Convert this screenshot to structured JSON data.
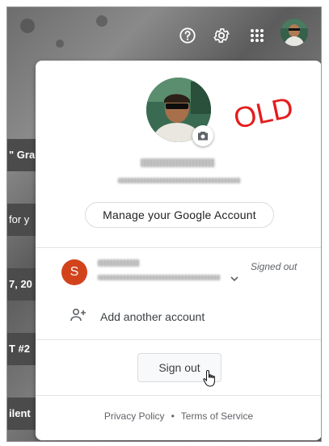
{
  "topbar": {
    "help_icon": "help-circle-icon",
    "settings_icon": "gear-icon",
    "apps_icon": "apps-grid-icon",
    "avatar_icon": "profile-avatar"
  },
  "background_rows": [
    "\" Gra",
    "for y",
    "7, 20",
    "T #2",
    "ilent"
  ],
  "panel": {
    "annotation": "OLD",
    "manage_account_label": "Manage your Google Account",
    "account_status": "Signed out",
    "account_initial": "S",
    "add_account_label": "Add another account",
    "sign_out_label": "Sign out",
    "footer": {
      "privacy": "Privacy Policy",
      "separator": "•",
      "terms": "Terms of Service"
    }
  },
  "colors": {
    "account_avatar": "#d2431c",
    "annotation": "#e51c1c"
  }
}
